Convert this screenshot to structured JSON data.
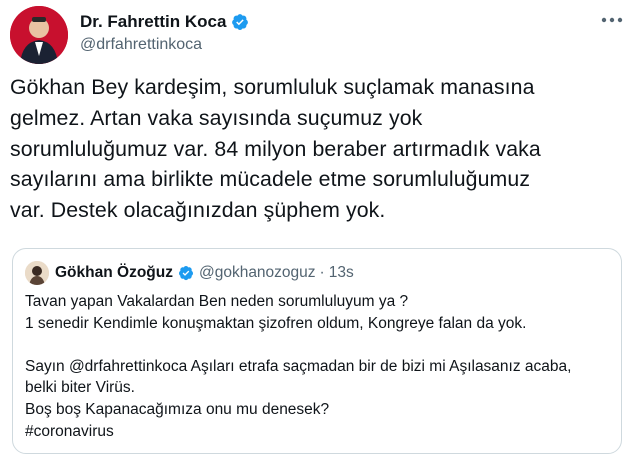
{
  "author": {
    "name": "Dr. Fahrettin Koca",
    "handle": "@drfahrettinkoca"
  },
  "tweet": {
    "text": "Gökhan Bey kardeşim, sorumluluk suçlamak manasına\ngelmez. Artan vaka sayısında suçumuz yok\nsorumluluğumuz var. 84 milyon beraber artırmadık vaka\nsayılarını ama birlikte mücadele etme sorumluluğumuz\nvar. Destek olacağınızdan şüphem yok."
  },
  "quote": {
    "name": "Gökhan Özoğuz",
    "handle": "@gokhanozoguz",
    "separator": "·",
    "time": "13s",
    "text": "Tavan yapan Vakalardan Ben neden sorumluluyum ya ?\n1 senedir Kendimle konuşmaktan şizofren oldum, Kongreye falan da yok.\n\nSayın @drfahrettinkoca Aşıları etrafa saçmadan bir de bizi mi Aşılasanız acaba,\nbelki biter Virüs.\nBoş boş Kapanacağımıza onu mu denesek?\n#coronavirus"
  },
  "icons": {
    "verified": "verified-badge-icon",
    "more": "more-options-icon"
  },
  "colors": {
    "verified": "#1d9bf0",
    "secondary_text": "#536471",
    "border": "#cfd9de",
    "avatar_bg": "#c8102e"
  }
}
